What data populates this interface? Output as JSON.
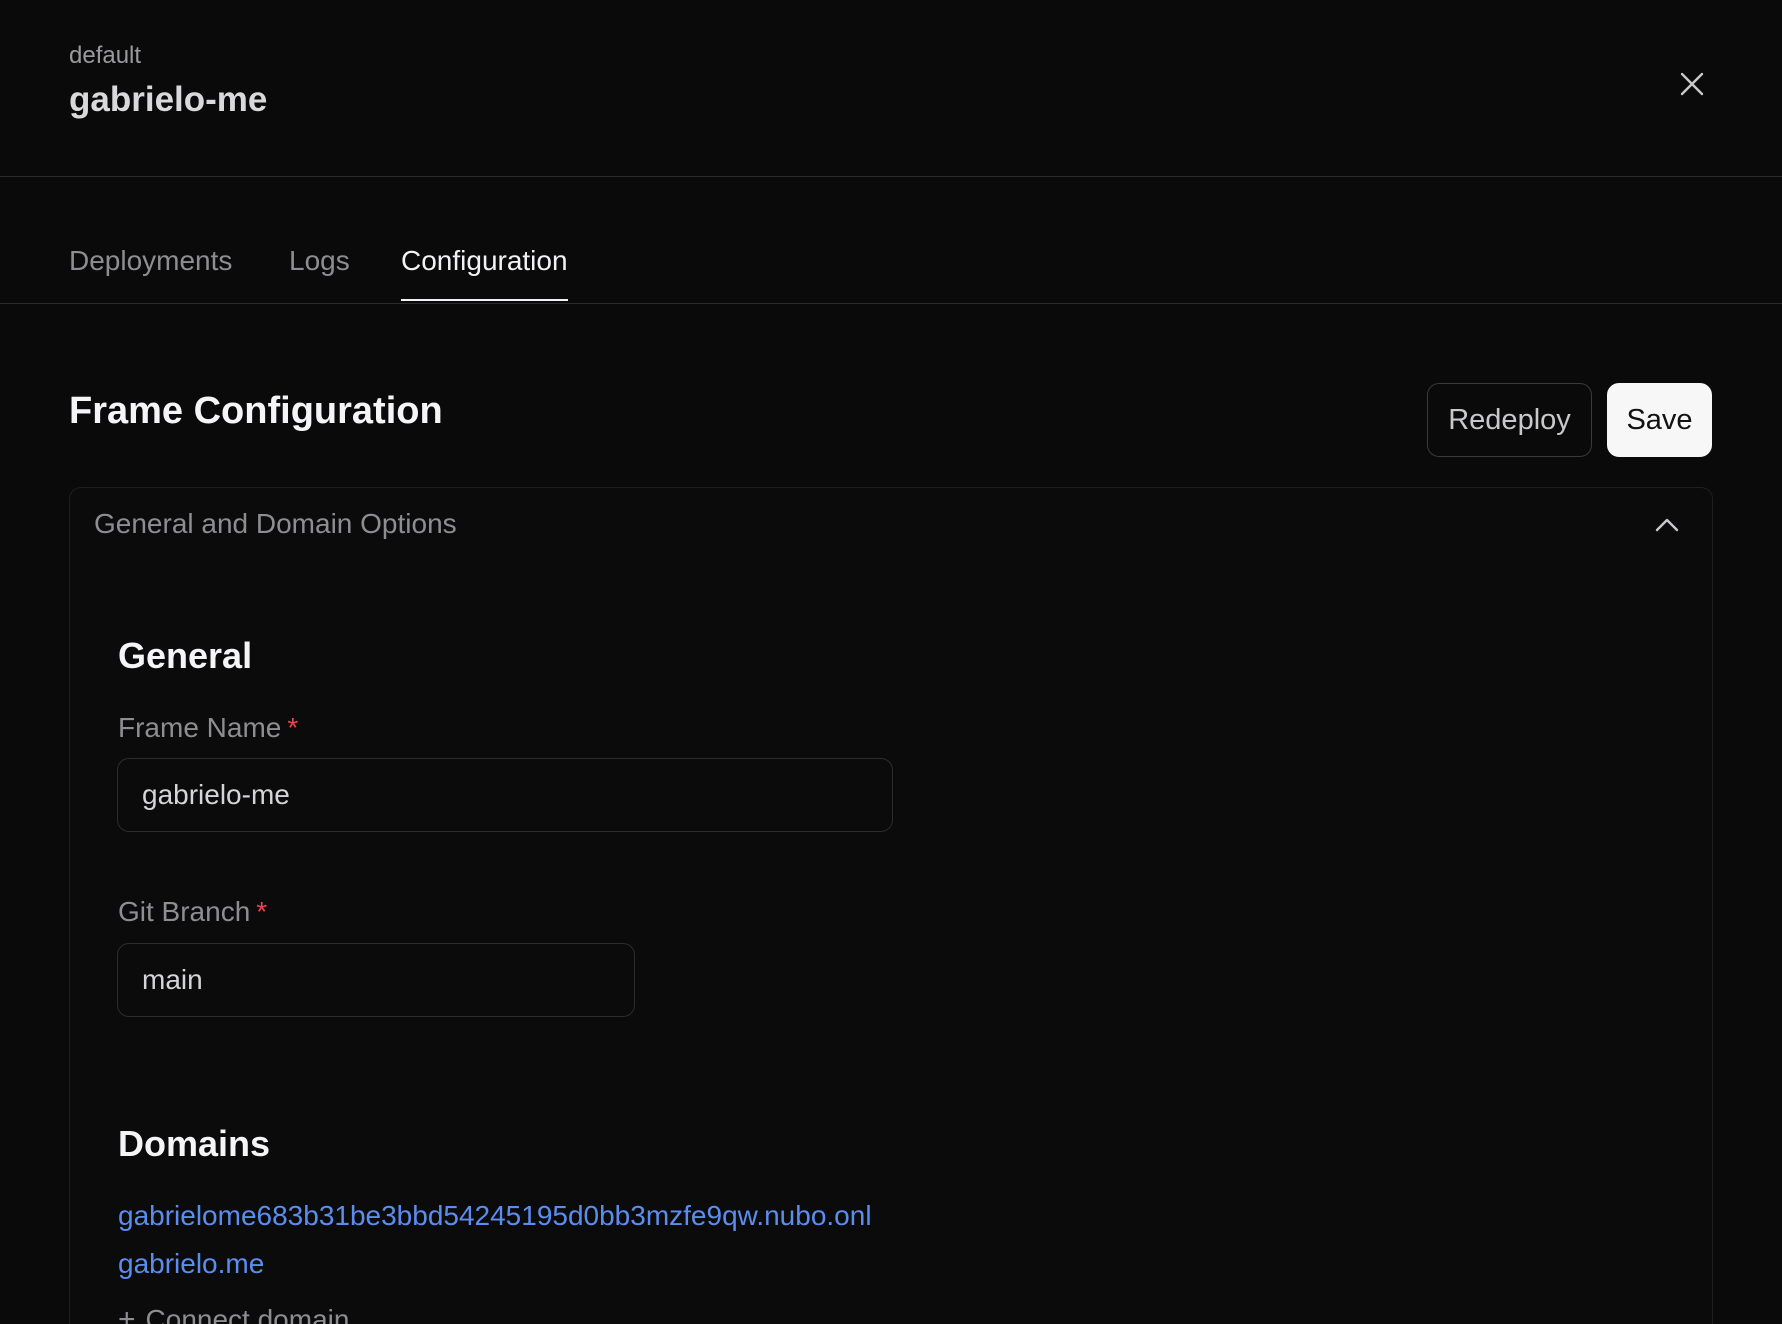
{
  "header": {
    "workspace": "default",
    "project": "gabrielo-me"
  },
  "tabs": [
    {
      "label": "Deployments"
    },
    {
      "label": "Logs"
    },
    {
      "label": "Configuration",
      "active": true
    }
  ],
  "section": {
    "title": "Frame Configuration",
    "redeploy_label": "Redeploy",
    "save_label": "Save"
  },
  "panel": {
    "title": "General and Domain Options",
    "general_heading": "General",
    "frame_name": {
      "label": "Frame Name",
      "required_mark": "*",
      "value": "gabrielo-me"
    },
    "git_branch": {
      "label": "Git Branch",
      "required_mark": "*",
      "value": "main"
    },
    "domains_heading": "Domains",
    "domains": [
      "gabrielome683b31be3bbd54245195d0bb3mzfe9qw.nubo.onl",
      "gabrielo.me"
    ],
    "connect_domain_label": "Connect domain"
  },
  "icons": {
    "close": "close-icon",
    "collapse": "chevron-up-icon",
    "add": "plus-icon"
  },
  "colors": {
    "background": "#0a0a0b",
    "link": "#5b8def",
    "required": "#e5484d",
    "save_button": "#f7f7f8"
  }
}
